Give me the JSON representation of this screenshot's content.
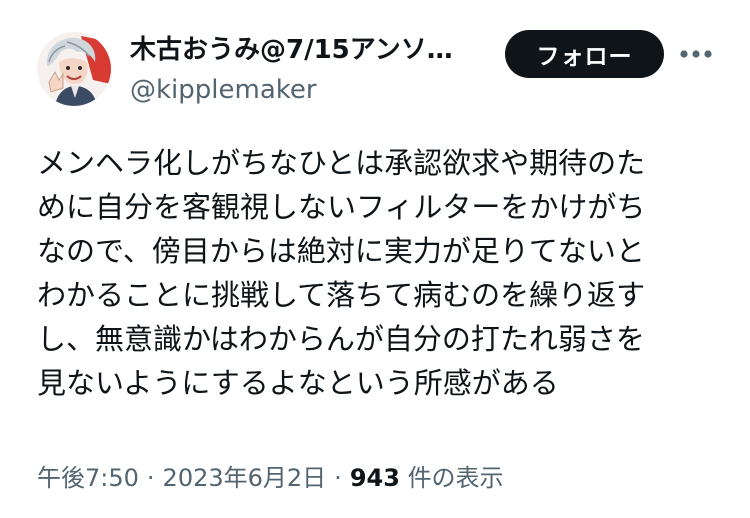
{
  "author": {
    "display_name": "木古おうみ@7/15アンソ…",
    "handle": "@kipplemaker",
    "avatar_icon": "avatar-illustration-icon"
  },
  "actions": {
    "follow_label": "フォロー",
    "more_icon": "more-options-icon"
  },
  "tweet": {
    "lines": [
      "メンヘラ化しがちなひとは承認欲求や期待のた",
      "めに自分を客観視しないフィルターをかけがち",
      "なので、傍目からは絶対に実力が足りてないと",
      "わかることに挑戦して落ちて病むのを繰り返す",
      "し、無意識かはわからんが自分の打たれ弱さを",
      "見ないようにするよなという所感がある"
    ]
  },
  "meta": {
    "time": "午後7:50",
    "separator": "·",
    "date": "2023年6月2日",
    "views_count": "943",
    "views_label": "件の表示"
  },
  "colors": {
    "text_primary": "#0f1419",
    "text_secondary": "#536471",
    "button_bg": "#0f1419",
    "button_text": "#ffffff"
  }
}
